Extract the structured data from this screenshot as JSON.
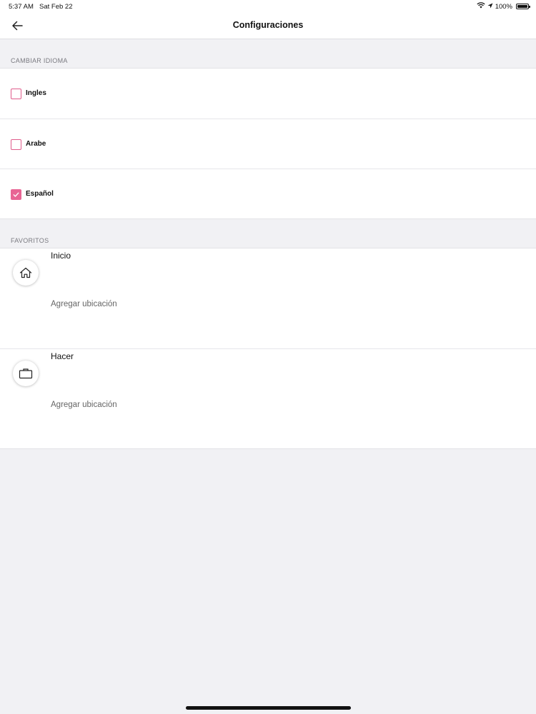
{
  "status_bar": {
    "time": "5:37 AM",
    "date": "Sat Feb 22",
    "battery": "100%",
    "icons": [
      "wifi-icon",
      "location-arrow-icon",
      "battery-icon"
    ]
  },
  "nav": {
    "title": "Configuraciones",
    "back_icon": "arrow-left-icon"
  },
  "language_section": {
    "header": "CAMBIAR IDIOMA",
    "options": [
      {
        "label": "Ingles",
        "checked": false
      },
      {
        "label": "Arabe",
        "checked": false
      },
      {
        "label": "Español",
        "checked": true
      }
    ]
  },
  "favorites_section": {
    "header": "FAVORITOS",
    "items": [
      {
        "title": "Inicio",
        "subtitle": "Agregar ubicación",
        "icon": "home-icon"
      },
      {
        "title": "Hacer",
        "subtitle": "Agregar ubicación",
        "icon": "briefcase-icon"
      }
    ]
  },
  "colors": {
    "accent": "#e86594",
    "background": "#f1f1f4",
    "surface": "#ffffff"
  }
}
